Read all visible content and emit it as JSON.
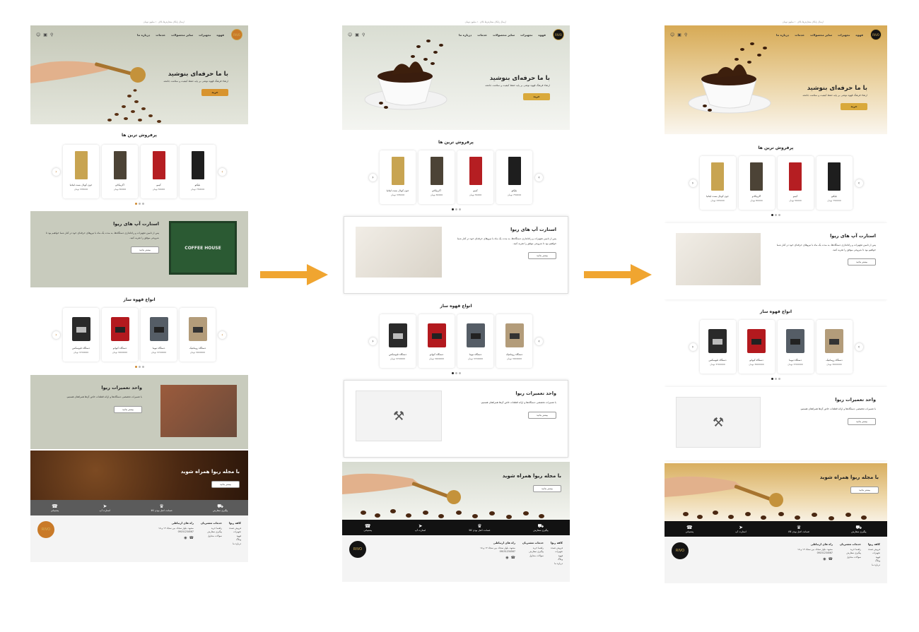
{
  "top_note": "ارسال رایگان سفارش‌ها بالای ۱۰ میلیون تومان",
  "brand": {
    "logo_text": "RIVO"
  },
  "nav": {
    "items": [
      "قهوه",
      "تجهیزات",
      "سایر محصولات",
      "خدمات",
      "درباره ما"
    ]
  },
  "hero": {
    "title": "با ما حرفه‌ای بنوشید",
    "subtitle": "ارتقاء فرهنگ قهوه نوشی بر پایه حفظ کیفیت و سلامت جامعه",
    "button": "خرید"
  },
  "bestsellers": {
    "title": "پرفروش ترین ها",
    "items": [
      {
        "name": "بلیکتو",
        "price": "750000 تومان"
      },
      {
        "name": "کیمو",
        "price": "56000 تومان"
      },
      {
        "name": "آکربیکادو",
        "price": "80000 تومان"
      },
      {
        "name": "جون کوبال بست لیتانیا",
        "price": "335000 تومان"
      }
    ]
  },
  "startup": {
    "title": "استارت آپ های ریوا",
    "body": "پس از تامین تجهیزات و راه‌اندازی دستگاه‌ها، به مدت یک ماه با نیروهای حرفه‌ای خود در کنار شما خواهیم بود تا شروعی موفق را تجربه کنید.",
    "button": "بیشتر بدانید",
    "image_label": "COFFEE HOUSE"
  },
  "machines": {
    "title": "انواع قهوه ساز",
    "items": [
      {
        "name": "دستگاه رومانتیک",
        "price": "3000000 تومان"
      },
      {
        "name": "دستگاه نیوما",
        "price": "3700000 تومان"
      },
      {
        "name": "دستگاه کیوانو",
        "price": "3900000 تومان"
      },
      {
        "name": "دستگاه تلیوسکس",
        "price": "3700000 تومان"
      }
    ]
  },
  "repair": {
    "title": "واحد تعمیرات ریوا",
    "body": "با تعمیرات تخصصی دستگاه‌ها و ارائه قطعات خاص آن‌ها همراهتان هستیم.",
    "button": "بیشتر بدانید"
  },
  "magazine": {
    "title": "با مجله ریوا همراه شوید",
    "button": "بیشتر بدانید"
  },
  "features": [
    {
      "label": "پیگیری سفارش",
      "icon": "truck-icon"
    },
    {
      "label": "ضمانت اصل بودن کالا",
      "icon": "award-icon"
    },
    {
      "label": "استارت آپ",
      "icon": "rocket-icon"
    },
    {
      "label": "پشتیبانی",
      "icon": "headset-icon"
    }
  ],
  "footer": {
    "cols": [
      {
        "heading": "کافه ریوا",
        "links": [
          "فروش عمده",
          "تجهیزات",
          "قهوه",
          "وبلاگ",
          "درباره ما"
        ]
      },
      {
        "heading": "خدمات مشتریان",
        "links": [
          "راهنما خرید",
          "پیگیری سفارش",
          "سوالات متداول"
        ]
      },
      {
        "heading": "راه های ارتباطی",
        "links": [
          "مشهد، بلوار سجاد، بین سجاد ۱۳ و ۱۵",
          "09151234567"
        ]
      }
    ]
  },
  "colors": {
    "v1_bg": "#c8cbbd",
    "v2_hero": "#dfe3d8",
    "v3_hero": "#d9ad5c",
    "accent": "#d9a93b",
    "flow_arrow": "#f0a530",
    "dark": "#121212"
  }
}
